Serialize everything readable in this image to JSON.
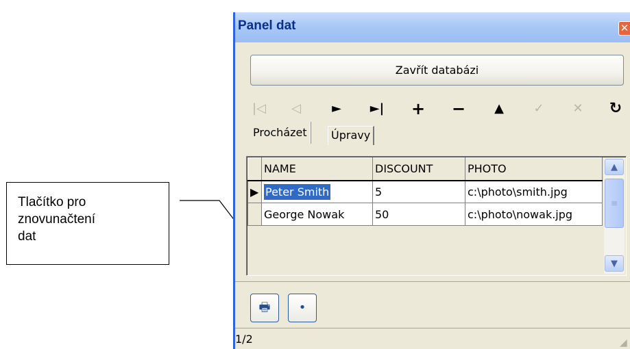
{
  "callout": {
    "lines": [
      "Tlačítko pro",
      "znovunačtení",
      "dat"
    ]
  },
  "window": {
    "title": "Panel dat",
    "close_glyph": "✕"
  },
  "close_db_button": "Zavřít databázi",
  "navigator": [
    {
      "name": "first",
      "glyph": "|◁",
      "enabled": false
    },
    {
      "name": "prior",
      "glyph": "◁",
      "enabled": false
    },
    {
      "name": "next",
      "glyph": "►",
      "enabled": true
    },
    {
      "name": "last",
      "glyph": "►|",
      "enabled": true
    },
    {
      "name": "insert",
      "glyph": "+",
      "enabled": true
    },
    {
      "name": "delete",
      "glyph": "−",
      "enabled": true
    },
    {
      "name": "edit",
      "glyph": "▲",
      "enabled": true
    },
    {
      "name": "post",
      "glyph": "✓",
      "enabled": false
    },
    {
      "name": "cancel",
      "glyph": "✕",
      "enabled": false
    },
    {
      "name": "refresh",
      "glyph": "↻",
      "enabled": true
    }
  ],
  "tabs": {
    "browse": "Procházet",
    "edit": "Úpravy"
  },
  "grid": {
    "columns": [
      "NAME",
      "DISCOUNT",
      "PHOTO"
    ],
    "rows": [
      [
        "Peter Smith",
        "5",
        "c:\\photo\\smith.jpg"
      ],
      [
        "George Nowak",
        "50",
        "c:\\photo\\nowak.jpg"
      ]
    ],
    "current_row_marker": "▶"
  },
  "bottom_buttons": {
    "print_glyph": "🖶",
    "reload_glyph": "•"
  },
  "status": {
    "record": "1/2"
  },
  "colors": {
    "accent": "#2b63e0",
    "selection": "#316ac5",
    "face": "#ece9d8"
  }
}
